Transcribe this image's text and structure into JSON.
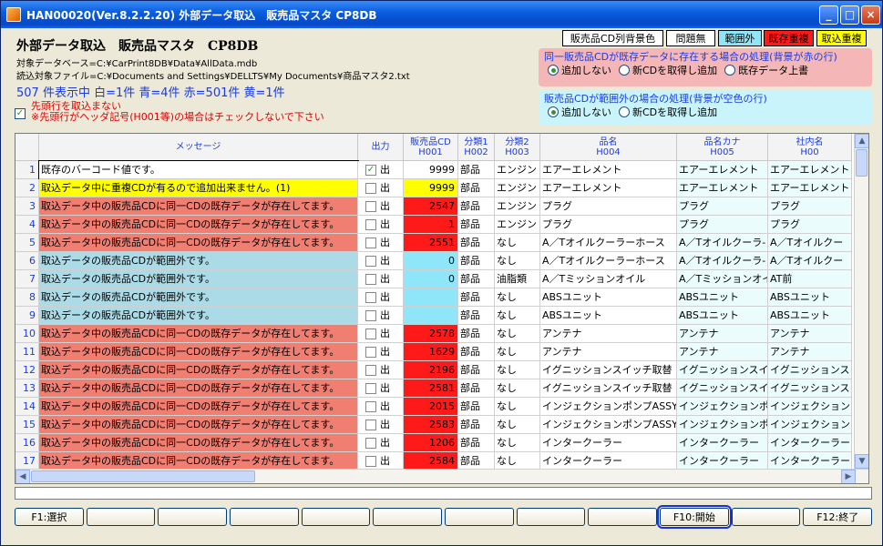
{
  "window": {
    "title": "HAN00020(Ver.8.2.2.20) 外部データ取込　販売品マスタ CP8DB",
    "min": "_",
    "max": "□",
    "close": "×"
  },
  "header": {
    "title": "外部データ取込　販売品マスタ　CP8DB",
    "db_line": "対象データベース=C:¥CarPrint8DB¥Data¥AllData.mdb",
    "file_line": "読込対象ファイル=C:¥Documents and Settings¥DELLTS¥My Documents¥商品マスタ2.txt",
    "counts": "507 件表示中 白=1件 青=4件 赤=501件 黄=1件",
    "skip_first_row": "先頭行を取込まない",
    "skip_note": "※先頭行がヘッダ記号(H001等)の場合はチェックしないで下さい",
    "skip_checked": "✓"
  },
  "legend": [
    {
      "label": "販売品CD列背景色",
      "color": "#ffffff",
      "text": "#000000"
    },
    {
      "label": "問題無",
      "color": "#ffffff",
      "text": "#000000"
    },
    {
      "label": "範囲外",
      "color": "#8fe6f8",
      "text": "#000000"
    },
    {
      "label": "既存重複",
      "color": "#ff1a1a",
      "text": "#000000"
    },
    {
      "label": "取込重複",
      "color": "#ffff00",
      "text": "#000000"
    }
  ],
  "options": {
    "dup_title": "同一販売品CDが既存データに存在する場合の処理(背景が赤の行)",
    "dup_choices": [
      "追加しない",
      "新CDを取得し追加",
      "既存データ上書"
    ],
    "dup_selected": 0,
    "range_title": "販売品CDが範囲外の場合の処理(背景が空色の行)",
    "range_choices": [
      "追加しない",
      "新CDを取得し追加"
    ],
    "range_selected": 0
  },
  "grid": {
    "columns": [
      {
        "line1": "メッセージ",
        "line2": ""
      },
      {
        "line1": "出力",
        "line2": ""
      },
      {
        "line1": "販売品CD",
        "line2": "H001"
      },
      {
        "line1": "分類1",
        "line2": "H002"
      },
      {
        "line1": "分類2",
        "line2": "H003"
      },
      {
        "line1": "品名",
        "line2": "H004"
      },
      {
        "line1": "品名カナ",
        "line2": "H005"
      },
      {
        "line1": "社内名",
        "line2": "H00"
      }
    ],
    "out_label": "出",
    "rows": [
      {
        "n": "1",
        "msg": "既存のバーコード値です。",
        "chk": "✓",
        "cd": "9999",
        "c1": "部品",
        "c2": "エンジン",
        "name": "エアーエレメント",
        "kana": "エアーエレメント",
        "inhouse": "エアーエレメント",
        "state": "white"
      },
      {
        "n": "2",
        "msg": "取込データ中に重複CDが有るので追加出来ません。(1)",
        "chk": "",
        "cd": "9999",
        "c1": "部品",
        "c2": "エンジン",
        "name": "エアーエレメント",
        "kana": "エアーエレメント",
        "inhouse": "エアーエレメント",
        "state": "yellow"
      },
      {
        "n": "3",
        "msg": "取込データ中の販売品CDに同一CDの既存データが存在してます。",
        "chk": "",
        "cd": "2547",
        "c1": "部品",
        "c2": "エンジン",
        "name": "プラグ",
        "kana": "プラグ",
        "inhouse": "プラグ",
        "state": "red"
      },
      {
        "n": "4",
        "msg": "取込データ中の販売品CDに同一CDの既存データが存在してます。",
        "chk": "",
        "cd": "1",
        "c1": "部品",
        "c2": "エンジン",
        "name": "プラグ",
        "kana": "プラグ",
        "inhouse": "プラグ",
        "state": "red"
      },
      {
        "n": "5",
        "msg": "取込データ中の販売品CDに同一CDの既存データが存在してます。",
        "chk": "",
        "cd": "2551",
        "c1": "部品",
        "c2": "なし",
        "name": "A／Tオイルクーラーホース",
        "kana": "A／Tオイルクーラ-",
        "inhouse": "A／Tオイルクー",
        "state": "red"
      },
      {
        "n": "6",
        "msg": "取込データの販売品CDが範囲外です。",
        "chk": "",
        "cd": "0",
        "c1": "部品",
        "c2": "なし",
        "name": "A／Tオイルクーラーホース",
        "kana": "A／Tオイルクーラ-",
        "inhouse": "A／Tオイルクー",
        "state": "blue"
      },
      {
        "n": "7",
        "msg": "取込データの販売品CDが範囲外です。",
        "chk": "",
        "cd": "0",
        "c1": "部品",
        "c2": "油脂類",
        "name": "A／Tミッションオイル",
        "kana": "A／Tミッションオイ",
        "inhouse": "AT前",
        "state": "blue"
      },
      {
        "n": "8",
        "msg": "取込データの販売品CDが範囲外です。",
        "chk": "",
        "cd": "",
        "c1": "部品",
        "c2": "なし",
        "name": "ABSユニット",
        "kana": "ABSユニット",
        "inhouse": "ABSユニット",
        "state": "blue"
      },
      {
        "n": "9",
        "msg": "取込データの販売品CDが範囲外です。",
        "chk": "",
        "cd": "",
        "c1": "部品",
        "c2": "なし",
        "name": "ABSユニット",
        "kana": "ABSユニット",
        "inhouse": "ABSユニット",
        "state": "blue"
      },
      {
        "n": "10",
        "msg": "取込データ中の販売品CDに同一CDの既存データが存在してます。",
        "chk": "",
        "cd": "2578",
        "c1": "部品",
        "c2": "なし",
        "name": "アンテナ",
        "kana": "アンテナ",
        "inhouse": "アンテナ",
        "state": "red"
      },
      {
        "n": "11",
        "msg": "取込データ中の販売品CDに同一CDの既存データが存在してます。",
        "chk": "",
        "cd": "1629",
        "c1": "部品",
        "c2": "なし",
        "name": "アンテナ",
        "kana": "アンテナ",
        "inhouse": "アンテナ",
        "state": "red"
      },
      {
        "n": "12",
        "msg": "取込データ中の販売品CDに同一CDの既存データが存在してます。",
        "chk": "",
        "cd": "2196",
        "c1": "部品",
        "c2": "なし",
        "name": "イグニッションスイッチ取替",
        "kana": "イグニッションスイッ",
        "inhouse": "イグニッションス",
        "state": "red"
      },
      {
        "n": "13",
        "msg": "取込データ中の販売品CDに同一CDの既存データが存在してます。",
        "chk": "",
        "cd": "2581",
        "c1": "部品",
        "c2": "なし",
        "name": "イグニッションスイッチ取替",
        "kana": "イグニッションスイッ",
        "inhouse": "イグニッションス",
        "state": "red"
      },
      {
        "n": "14",
        "msg": "取込データ中の販売品CDに同一CDの既存データが存在してます。",
        "chk": "",
        "cd": "2015",
        "c1": "部品",
        "c2": "なし",
        "name": "インジェクションポンプASSY",
        "kana": "インジェクションポン",
        "inhouse": "インジェクション",
        "state": "red"
      },
      {
        "n": "15",
        "msg": "取込データ中の販売品CDに同一CDの既存データが存在してます。",
        "chk": "",
        "cd": "2583",
        "c1": "部品",
        "c2": "なし",
        "name": "インジェクションポンプASSY",
        "kana": "インジェクションポン",
        "inhouse": "インジェクション",
        "state": "red"
      },
      {
        "n": "16",
        "msg": "取込データ中の販売品CDに同一CDの既存データが存在してます。",
        "chk": "",
        "cd": "1206",
        "c1": "部品",
        "c2": "なし",
        "name": "インタークーラー",
        "kana": "インタークーラー",
        "inhouse": "インタークーラー",
        "state": "red"
      },
      {
        "n": "17",
        "msg": "取込データ中の販売品CDに同一CDの既存データが存在してます。",
        "chk": "",
        "cd": "2584",
        "c1": "部品",
        "c2": "なし",
        "name": "インタークーラー",
        "kana": "インタークーラー",
        "inhouse": "インタークーラー",
        "state": "red"
      }
    ]
  },
  "colors": {
    "red": "#f07f72",
    "red_cd": "#ff1a1a",
    "blue": "#acdbe8",
    "blue_cd": "#8fe6f8",
    "yellow": "#ffff00",
    "white": "#ffffff",
    "name_bg": "#eafcfc"
  },
  "fkeys": [
    "F1:選択",
    "",
    "",
    "",
    "",
    "",
    "",
    "",
    "",
    "F10:開始",
    "",
    "F12:終了"
  ],
  "fkey_focus": 9
}
